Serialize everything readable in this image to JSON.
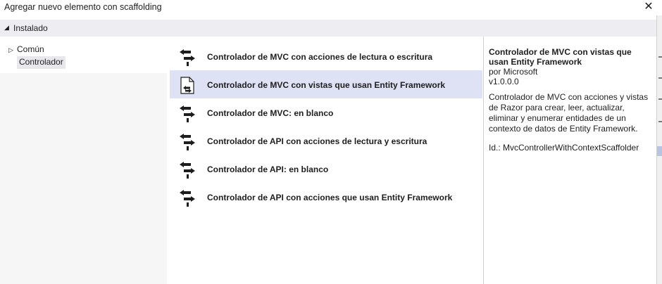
{
  "window": {
    "title": "Agregar nuevo elemento con scaffolding",
    "close_glyph": "✕"
  },
  "installed": {
    "label": "Instalado"
  },
  "tree": {
    "items": [
      {
        "label": "Común",
        "expandable": true
      },
      {
        "label": "Controlador",
        "selected": true
      }
    ]
  },
  "templates": [
    {
      "label": "Controlador de MVC con acciones de lectura o escritura",
      "icon": "controller-icon"
    },
    {
      "label": "Controlador de MVC con vistas que usan Entity Framework",
      "icon": "controller-views-icon",
      "selected": true
    },
    {
      "label": "Controlador de MVC: en blanco",
      "icon": "controller-icon"
    },
    {
      "label": "Controlador de API con acciones de lectura y escritura",
      "icon": "controller-icon"
    },
    {
      "label": "Controlador de API: en blanco",
      "icon": "controller-icon"
    },
    {
      "label": "Controlador de API con acciones que usan Entity Framework",
      "icon": "controller-icon"
    }
  ],
  "details": {
    "name": "Controlador de MVC con vistas que usan Entity Framework",
    "author": "por Microsoft",
    "version": "v1.0.0.0",
    "description": "Controlador de MVC con acciones y vistas de Razor para crear, leer, actualizar, eliminar y enumerar entidades de un contexto de datos de Entity Framework.",
    "id": "Id.: MvcControllerWithContextScaffolder"
  },
  "colors": {
    "selected_row": "#dfe1f5",
    "header_bar": "#eeeef2",
    "tree_bg": "#f6f6f6"
  }
}
